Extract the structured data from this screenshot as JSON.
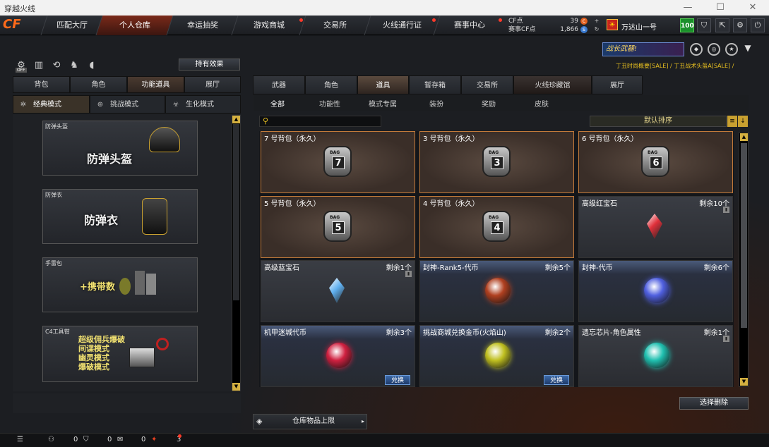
{
  "window": {
    "title": "穿越火线",
    "minimize": "—",
    "maximize": "☐",
    "close": "✕"
  },
  "nav": {
    "logo": "CF",
    "tabs": [
      "匹配大厅",
      "个人仓库",
      "幸运抽奖",
      "游戏商城",
      "交易所",
      "火线通行证",
      "赛事中心"
    ],
    "active_tab": "个人仓库"
  },
  "currency": {
    "cf_label": "CF点",
    "cf_value": "39",
    "match_label": "赛事CF点",
    "match_value": "1,866"
  },
  "user": {
    "name": "万达山一号",
    "rank_glyph": "☀",
    "level": "100"
  },
  "promo": {
    "banner": "战长武器!",
    "marquee": "丁丑时尚概要[SALE] / 丁丑战术头盔A[SALE] /"
  },
  "left": {
    "effects_button": "持有效果",
    "off_badge": "OFF",
    "tabs": [
      "背包",
      "角色",
      "功能道具",
      "展厅"
    ],
    "active_tab": "功能道具",
    "modes": [
      "经典模式",
      "挑战模式",
      "生化模式"
    ],
    "active_mode": "经典模式",
    "items": [
      {
        "caption": "防弹头盔",
        "title": "防弹头盔"
      },
      {
        "caption": "防弹衣",
        "title": "防弹衣"
      },
      {
        "caption": "手雷包",
        "title": "+携带数"
      },
      {
        "caption": "C4工具钳",
        "lines": [
          "超级佣兵爆破",
          "间谍模式",
          "幽灵模式",
          "爆破模式"
        ]
      }
    ]
  },
  "right": {
    "tabs": [
      "武器",
      "角色",
      "道具",
      "暂存箱",
      "交易所",
      "火线珍藏馆",
      "展厅"
    ],
    "active_tab": "道具",
    "subtabs": [
      "全部",
      "功能性",
      "模式专属",
      "装扮",
      "奖励",
      "皮肤"
    ],
    "active_subtab": "全部",
    "search_placeholder": "",
    "sort_label": "默认排序",
    "items": [
      {
        "name": "7 号背包（永久）",
        "kind": "bag",
        "bag_num": "7",
        "bag_label": "BAG"
      },
      {
        "name": "3 号背包（永久）",
        "kind": "bag",
        "bag_num": "3",
        "bag_label": "BAG"
      },
      {
        "name": "6 号背包（永久）",
        "kind": "bag",
        "bag_num": "6",
        "bag_label": "BAG"
      },
      {
        "name": "5 号背包（永久）",
        "kind": "bag",
        "bag_num": "5",
        "bag_label": "BAG"
      },
      {
        "name": "4 号背包（永久）",
        "kind": "bag",
        "bag_num": "4",
        "bag_label": "BAG"
      },
      {
        "name": "高级红宝石",
        "kind": "gem",
        "count": "剩余10个",
        "color": "#e0303a"
      },
      {
        "name": "高级蓝宝石",
        "kind": "gem",
        "count": "剩余1个",
        "color": "#60b0f0"
      },
      {
        "name": "封神-Rank5-代币",
        "kind": "coin",
        "count": "剩余5个",
        "color": "#b04020"
      },
      {
        "name": "封神-代币",
        "kind": "coin",
        "count": "剩余6个",
        "color": "#5060e0"
      },
      {
        "name": "机甲迷城代币",
        "kind": "coin",
        "count": "剩余3个",
        "color": "#d02040",
        "action": "兑换"
      },
      {
        "name": "挑战商城兑换金币(火焰山)",
        "kind": "coin",
        "count": "剩余2个",
        "color": "#c0c020",
        "action": "兑换"
      },
      {
        "name": "遗忘芯片-角色属性",
        "kind": "coin",
        "count": "剩余1个",
        "color": "#20c0b0"
      }
    ],
    "capacity_button": "仓库物品上限",
    "delete_button": "选择删除"
  },
  "statusbar": {
    "v1": "0",
    "v2": "0",
    "v3": "0",
    "v4": "3"
  },
  "colors": {
    "accent": "#ff6a1a",
    "bag_border": "#c27a3a",
    "exchange_blue": "#3c6aa8",
    "sort_gold": "#c8a030"
  }
}
